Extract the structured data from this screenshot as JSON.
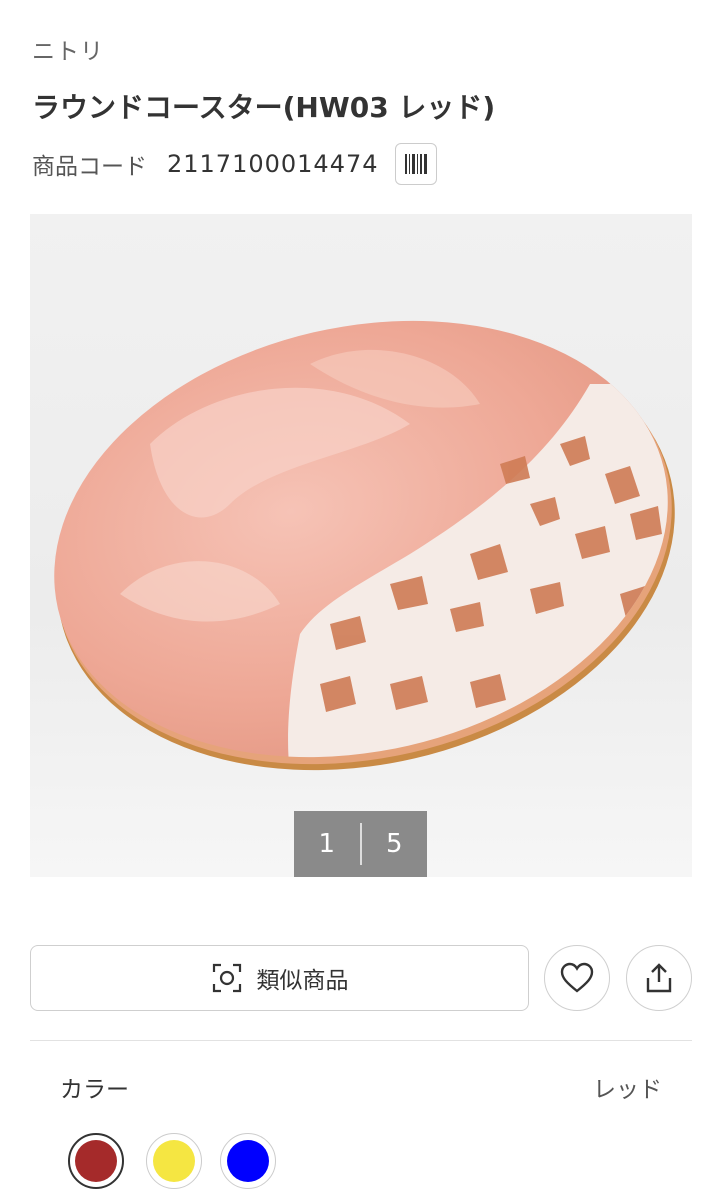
{
  "brand": "ニトリ",
  "product": {
    "title": "ラウンドコースター(HW03 レッド)",
    "code_label": "商品コード",
    "code_value": "2117100014474"
  },
  "gallery": {
    "current": "1",
    "total": "5"
  },
  "actions": {
    "similar_label": "類似商品",
    "favorite_icon": "heart-icon",
    "share_icon": "share-icon",
    "similar_icon": "camera-scan-icon"
  },
  "color": {
    "label": "カラー",
    "selected_value": "レッド",
    "swatches": [
      {
        "name": "red",
        "hex": "#a52a2a",
        "selected": true
      },
      {
        "name": "yellow",
        "hex": "#f5e642",
        "selected": false
      },
      {
        "name": "blue",
        "hex": "#0000ff",
        "selected": false
      }
    ]
  }
}
